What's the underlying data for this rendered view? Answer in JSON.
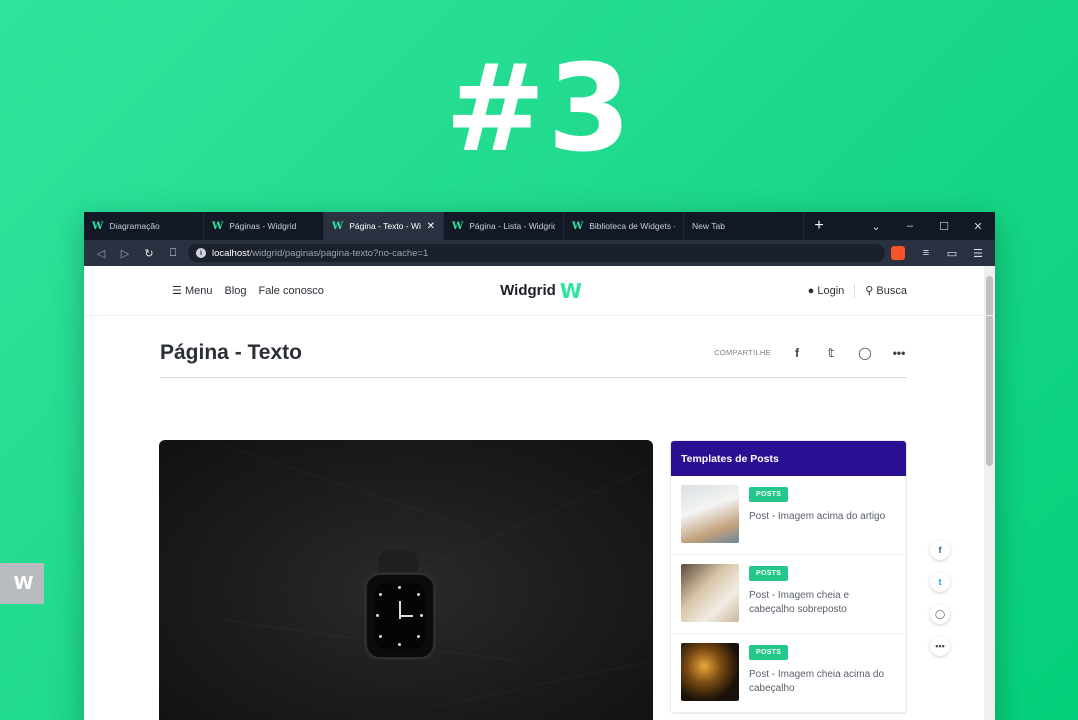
{
  "headline": "#3",
  "browser": {
    "tabs": [
      {
        "label": "Diagramação",
        "active": false
      },
      {
        "label": "Páginas - Widgrid",
        "active": false
      },
      {
        "label": "Página - Texto - Wi",
        "active": true
      },
      {
        "label": "Página - Lista - Widgrid",
        "active": false
      },
      {
        "label": "Biblioteca de Widgets -",
        "active": false
      },
      {
        "label": "New Tab",
        "active": false
      }
    ],
    "new_tab": "+",
    "controls": {
      "chevron": "⌄",
      "minimize": "–",
      "maximize": "☐",
      "close": "✕"
    },
    "url_host": "localhost",
    "url_path": "/widgrid/paginas/pagina-texto?no-cache=1"
  },
  "site": {
    "menu_label": "Menu",
    "blog_label": "Blog",
    "contact_label": "Fale conosco",
    "logo_text": "Widgrid",
    "logo_mark": "W",
    "login_label": "Login",
    "search_label": "Busca"
  },
  "page": {
    "title": "Página - Texto",
    "share_label": "COMPARTILHE"
  },
  "sidebar": {
    "title": "Templates de Posts",
    "posts": [
      {
        "badge": "POSTS",
        "title": "Post - Imagem acima do artigo"
      },
      {
        "badge": "POSTS",
        "title": "Post - Imagem cheia e cabeçalho sobreposto"
      },
      {
        "badge": "POSTS",
        "title": "Post - Imagem cheia acima do cabeçalho"
      }
    ]
  },
  "colors": {
    "accent": "#2ee59d",
    "sidebar_header": "#2b0f92",
    "badge": "#23c78a"
  }
}
